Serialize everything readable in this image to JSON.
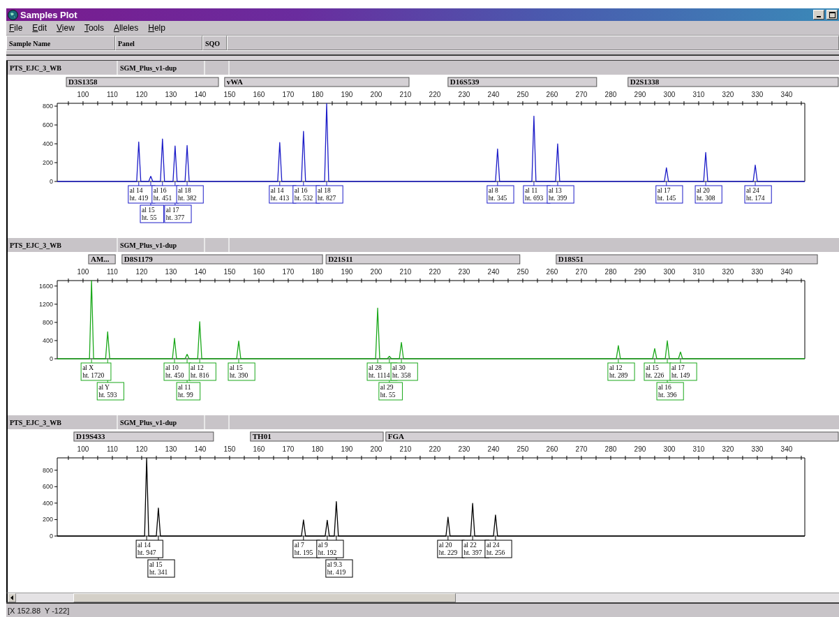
{
  "window": {
    "title": "Samples Plot"
  },
  "menu": [
    "File",
    "Edit",
    "View",
    "Tools",
    "Alleles",
    "Help"
  ],
  "columns": [
    "Sample Name",
    "Panel",
    "SQO"
  ],
  "panels": [
    {
      "sample": "PTS_EJC_3_WB",
      "panel": "SGM_Plus_v1-dup",
      "loci": [
        "D3S1358",
        "vWA",
        "D16S539",
        "D2S1338"
      ],
      "alleles": [
        {
          "allele": "al 14",
          "height": "ht. 419"
        },
        {
          "allele": "al 15",
          "height": "ht. 55"
        },
        {
          "allele": "al 16",
          "height": "ht. 451"
        },
        {
          "allele": "al 17",
          "height": "ht. 377"
        },
        {
          "allele": "al 18",
          "height": "ht. 382"
        },
        {
          "allele": "al 14",
          "height": "ht. 413"
        },
        {
          "allele": "al 16",
          "height": "ht. 532"
        },
        {
          "allele": "al 18",
          "height": "ht. 827"
        },
        {
          "allele": "al 8",
          "height": "ht. 345"
        },
        {
          "allele": "al 11",
          "height": "ht. 693"
        },
        {
          "allele": "al 13",
          "height": "ht. 399"
        },
        {
          "allele": "al 17",
          "height": "ht. 145"
        },
        {
          "allele": "al 20",
          "height": "ht. 308"
        },
        {
          "allele": "al 24",
          "height": "ht. 174"
        }
      ],
      "chart_data": {
        "type": "line",
        "xlim": [
          91.2,
          346.2
        ],
        "ylim": [
          0,
          830
        ],
        "xticks": [
          100,
          110,
          120,
          130,
          140,
          150,
          160,
          170,
          180,
          190,
          200,
          210,
          220,
          230,
          240,
          250,
          260,
          270,
          280,
          290,
          300,
          310,
          320,
          330,
          340
        ],
        "yticks": [
          0,
          200,
          400,
          600,
          800
        ],
        "x": [
          91.2,
          118.3,
          119,
          119.7,
          122.4,
          123.1,
          123.8,
          126.4,
          127.1,
          127.8,
          130.7,
          131.4,
          132.1,
          134.8,
          135.5,
          136.2,
          166.4,
          167.1,
          167.8,
          174.5,
          175.2,
          175.9,
          182.4,
          183.1,
          183.8,
          240.7,
          241.4,
          242.1,
          253.1,
          253.8,
          254.5,
          261.2,
          261.9,
          262.6,
          298.3,
          299,
          299.7,
          311.7,
          312.4,
          313.1,
          328.6,
          329.3,
          330,
          346.2
        ],
        "series": [
          {
            "color": "#1c1cc8",
            "values": [
              0,
              0,
              419,
              0,
              0,
              55,
              0,
              0,
              451,
              0,
              0,
              377,
              0,
              0,
              382,
              0,
              0,
              413,
              0,
              0,
              532,
              0,
              0,
              827,
              0,
              0,
              345,
              0,
              0,
              693,
              0,
              0,
              399,
              0,
              0,
              145,
              0,
              0,
              308,
              0,
              0,
              174,
              0,
              0
            ]
          }
        ]
      }
    },
    {
      "sample": "PTS_EJC_3_WB",
      "panel": "SGM_Plus_v1-dup",
      "loci": [
        "AM...",
        "D8S1179",
        "D21S11",
        "D18S51"
      ],
      "alleles": [
        {
          "allele": "al X",
          "height": "ht. 1720"
        },
        {
          "allele": "al Y",
          "height": "ht. 593"
        },
        {
          "allele": "al 10",
          "height": "ht. 450"
        },
        {
          "allele": "al 11",
          "height": "ht. 99"
        },
        {
          "allele": "al 12",
          "height": "ht. 816"
        },
        {
          "allele": "al 15",
          "height": "ht. 390"
        },
        {
          "allele": "al 28",
          "height": "ht. 1114"
        },
        {
          "allele": "al 29",
          "height": "ht. 55"
        },
        {
          "allele": "al 30",
          "height": "ht. 358"
        },
        {
          "allele": "al 12",
          "height": "ht. 289"
        },
        {
          "allele": "al 15",
          "height": "ht. 226"
        },
        {
          "allele": "al 16",
          "height": "ht. 396"
        },
        {
          "allele": "al 17",
          "height": "ht. 149"
        }
      ],
      "chart_data": {
        "type": "line",
        "xlim": [
          91.2,
          346.2
        ],
        "ylim": [
          0,
          1720
        ],
        "xticks": [
          100,
          110,
          120,
          130,
          140,
          150,
          160,
          170,
          180,
          190,
          200,
          210,
          220,
          230,
          240,
          250,
          260,
          270,
          280,
          290,
          300,
          310,
          320,
          330,
          340
        ],
        "yticks": [
          0,
          400,
          800,
          1200,
          1600
        ],
        "x": [
          91.2,
          102.2,
          102.9,
          103.6,
          107.7,
          108.4,
          109.1,
          130.5,
          131.2,
          131.9,
          134.8,
          135.5,
          136.2,
          139.1,
          139.8,
          140.5,
          152.4,
          153.1,
          153.8,
          199.8,
          200.5,
          201.2,
          203.8,
          204.5,
          205.2,
          207.9,
          208.6,
          209.3,
          281.9,
          282.6,
          283.3,
          294.3,
          295,
          295.7,
          298.6,
          299.3,
          300,
          303.1,
          303.8,
          304.5,
          346.2
        ],
        "series": [
          {
            "color": "#1aa81a",
            "values": [
              0,
              0,
              1720,
              0,
              0,
              593,
              0,
              0,
              450,
              0,
              0,
              99,
              0,
              0,
              816,
              0,
              0,
              390,
              0,
              0,
              1114,
              0,
              0,
              55,
              0,
              0,
              358,
              0,
              0,
              289,
              0,
              0,
              226,
              0,
              0,
              396,
              0,
              0,
              149,
              0,
              0
            ]
          }
        ]
      }
    },
    {
      "sample": "PTS_EJC_3_WB",
      "panel": "SGM_Plus_v1-dup",
      "loci": [
        "D19S433",
        "TH01",
        "FGA"
      ],
      "alleles": [
        {
          "allele": "al 14",
          "height": "ht. 947"
        },
        {
          "allele": "al 15",
          "height": "ht. 341"
        },
        {
          "allele": "al 7",
          "height": "ht. 195"
        },
        {
          "allele": "al 9",
          "height": "ht. 192"
        },
        {
          "allele": "al 9.3",
          "height": "ht. 419"
        },
        {
          "allele": "al 20",
          "height": "ht. 229"
        },
        {
          "allele": "al 22",
          "height": "ht. 397"
        },
        {
          "allele": "al 24",
          "height": "ht. 256"
        }
      ],
      "chart_data": {
        "type": "line",
        "xlim": [
          91.2,
          346.2
        ],
        "ylim": [
          0,
          950
        ],
        "xticks": [
          100,
          110,
          120,
          130,
          140,
          150,
          160,
          170,
          180,
          190,
          200,
          210,
          220,
          230,
          240,
          250,
          260,
          270,
          280,
          290,
          300,
          310,
          320,
          330,
          340
        ],
        "yticks": [
          0,
          200,
          400,
          600,
          800
        ],
        "x": [
          91.2,
          121,
          121.7,
          122.4,
          125,
          125.7,
          126.4,
          174.5,
          175.2,
          175.9,
          182.6,
          183.3,
          184,
          185.7,
          186.4,
          187.1,
          223.8,
          224.5,
          225.2,
          232.2,
          232.9,
          233.6,
          240,
          240.7,
          241.4,
          346.2
        ],
        "series": [
          {
            "color": "#000000",
            "values": [
              0,
              0,
              947,
              0,
              0,
              341,
              0,
              0,
              195,
              0,
              0,
              192,
              0,
              0,
              419,
              0,
              0,
              229,
              0,
              0,
              397,
              0,
              0,
              256,
              0,
              0
            ]
          }
        ]
      }
    }
  ],
  "status_bar": "[X 152.88  Y -122]"
}
